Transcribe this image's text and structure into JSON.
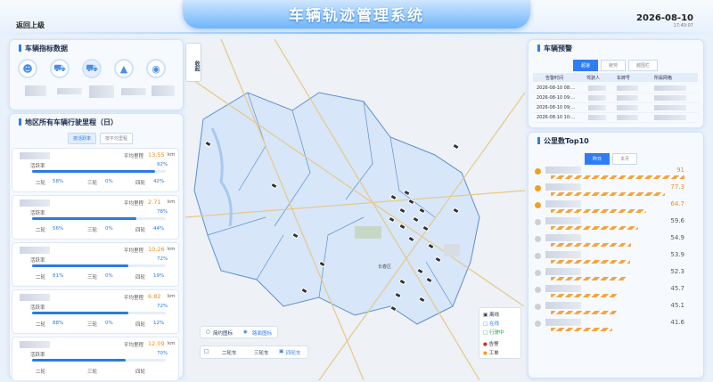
{
  "header": {
    "title": "车辆轨迹管理系统",
    "back": "返回上级",
    "date": "2026-08-10",
    "time": "17:40:07"
  },
  "vehicle_metrics": {
    "title": "车辆指标数据",
    "icons": [
      "person-icon",
      "car-icon",
      "sedan-icon",
      "barrier-icon",
      "chat-icon"
    ]
  },
  "mileage": {
    "title": "地区所有车辆行驶里程（日）",
    "tabs": [
      "按活跃率",
      "按平均里程"
    ],
    "avg_label": "平均里程",
    "active_label": "活跃率",
    "wheel2": "二轮",
    "wheel3": "三轮",
    "wheel4": "四轮",
    "unit": "km",
    "rows": [
      {
        "avg": "13.55",
        "active": "92%",
        "active_frac": 0.92,
        "w2": "58%",
        "w3": "0%",
        "w4": "42%"
      },
      {
        "avg": "2.71",
        "active": "78%",
        "active_frac": 0.78,
        "w2": "56%",
        "w3": "0%",
        "w4": "44%"
      },
      {
        "avg": "10.26",
        "active": "72%",
        "active_frac": 0.72,
        "w2": "81%",
        "w3": "0%",
        "w4": "19%"
      },
      {
        "avg": "6.82",
        "active": "72%",
        "active_frac": 0.72,
        "w2": "88%",
        "w3": "0%",
        "w4": "12%"
      },
      {
        "avg": "12.09",
        "active": "70%",
        "active_frac": 0.7,
        "w2": "",
        "w3": "",
        "w4": ""
      }
    ]
  },
  "map": {
    "collapse": "收起",
    "basemap": [
      "简约图标",
      "路面图标"
    ],
    "vehicle_types": [
      "二轮车",
      "三轮车",
      "四轮车"
    ],
    "status": [
      "离线",
      "在线",
      "行驶中",
      "告警",
      "工单"
    ],
    "district": "长春区"
  },
  "warning": {
    "title": "车辆预警",
    "tabs": [
      "超速",
      "疲劳",
      "越围栏"
    ],
    "cols": [
      "告警时间",
      "驾驶人",
      "车牌号",
      "所属网格"
    ],
    "rows": [
      "2026-08-10 08:...",
      "2026-08-10 09:...",
      "2026-08-10 09:...",
      "2026-08-10 10:..."
    ]
  },
  "top10": {
    "title": "公里数Top10",
    "tabs": [
      "昨日",
      "本月"
    ],
    "values": [
      "91",
      "77.3",
      "64.7",
      "59.6",
      "54.9",
      "53.9",
      "52.3",
      "45.7",
      "45.1",
      "41.6"
    ],
    "fracs": [
      1,
      0.85,
      0.71,
      0.65,
      0.6,
      0.59,
      0.57,
      0.5,
      0.49,
      0.46
    ]
  }
}
